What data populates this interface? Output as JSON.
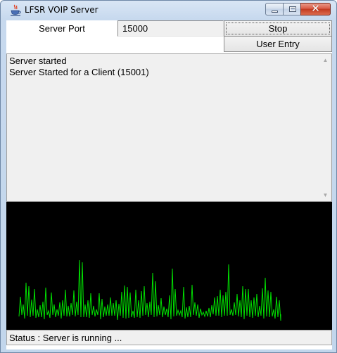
{
  "window": {
    "title": "LFSR VOIP Server",
    "icon": "java-cup-icon",
    "controls": [
      "minimize-icon",
      "maximize-icon",
      "close-icon"
    ],
    "close_glyph": "✕"
  },
  "form": {
    "port_label": "Server Port",
    "port_value": "15000",
    "stop_label": "Stop",
    "user_entry_label": "User Entry"
  },
  "log": {
    "lines": [
      "Server started",
      "Server Started for a Client (15001)"
    ]
  },
  "scope": {
    "background": "#000000",
    "trace_color": "#00e000"
  },
  "status": {
    "text": "Status : Server is running ..."
  }
}
